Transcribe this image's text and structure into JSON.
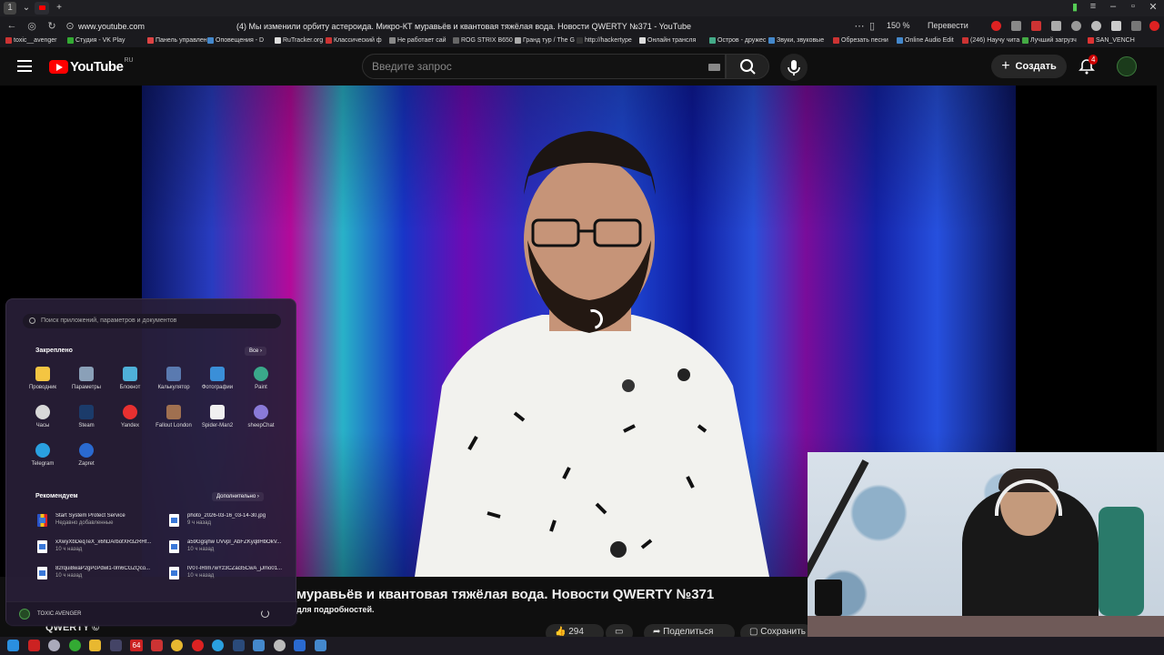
{
  "browser": {
    "url": "www.youtube.com",
    "page_title": "(4) Мы изменили орбиту астероида. Микро-КТ муравьёв и квантовая тяжёлая вода. Новости QWERTY №371 - YouTube",
    "zoom": "150 %",
    "translate": "Перевести",
    "tab_count_badge": "1",
    "bookmarks": [
      "toxic__avenger",
      "Студия - VK Play",
      "Панель управлен",
      "Оповещения - D",
      "RuTracker.org",
      "Классический ф",
      "Не работает сай",
      "ROG STRIX B650",
      "Гранд тур / The G",
      "http://hackertype",
      "Онлайн трансля",
      "Остров - дружес",
      "Звуки, звуковые",
      "Обрезать песни",
      "Online Audio Edit",
      "(246) Научу чита",
      "Лучший загрузч",
      "SAN_VENCH"
    ],
    "colors": {
      "tab_bg": "#1f1f23",
      "bar_bg": "#1a1a1e"
    }
  },
  "youtube": {
    "logo_text": "YouTube",
    "country_code": "RU",
    "search_placeholder": "Введите запрос",
    "create_label": "Создать",
    "notification_count": "4",
    "accent": "#ff0000"
  },
  "video": {
    "title_visible": "муравьёв и квантовая тяжёлая вода. Новости QWERTY №371",
    "subtitle_visible": "для подробностей.",
    "channel_visible": "QWERTY ©",
    "likes": "294",
    "share_label": "Поделиться",
    "save_label": "Сохранить"
  },
  "start_menu": {
    "search_placeholder": "Поиск приложений, параметров и документов",
    "pinned_heading": "Закреплено",
    "all_label": "Все",
    "pinned_apps": [
      {
        "label": "Проводник",
        "icon": "folder-icon",
        "color": "#f4c542"
      },
      {
        "label": "Параметры",
        "icon": "gear-icon",
        "color": "#8aa0b8"
      },
      {
        "label": "Блокнот",
        "icon": "notepad-icon",
        "color": "#4fb0d8"
      },
      {
        "label": "Калькулятор",
        "icon": "calculator-icon",
        "color": "#5a7ab0"
      },
      {
        "label": "Фотографии",
        "icon": "photos-icon",
        "color": "#3a8fd8"
      },
      {
        "label": "Paint",
        "icon": "paint-icon",
        "color": "#3aa88a"
      },
      {
        "label": "Часы",
        "icon": "clock-icon",
        "color": "#d8d8d8"
      },
      {
        "label": "Steam",
        "icon": "steam-icon",
        "color": "#1b3b6a"
      },
      {
        "label": "Yandex",
        "icon": "yandex-icon",
        "color": "#e83030"
      },
      {
        "label": "Fallout London",
        "icon": "fallout-icon",
        "color": "#a07050"
      },
      {
        "label": "Spider-Man2",
        "icon": "file-icon",
        "color": "#f0f0f0"
      },
      {
        "label": "sheepChat",
        "icon": "chat-icon",
        "color": "#8a7ad8"
      },
      {
        "label": "Telegram",
        "icon": "telegram-icon",
        "color": "#2aa0e0"
      },
      {
        "label": "Zapret",
        "icon": "globe-icon",
        "color": "#2a6ad0"
      }
    ],
    "recommended_heading": "Рекомендуем",
    "more_label": "Дополнительно",
    "recommended": [
      {
        "name": "Start System Protect Service",
        "time": "Недавно добавленные"
      },
      {
        "name": "photo_2026-03-16_03-14-30.jpg",
        "time": "9 ч назад"
      },
      {
        "name": "xXwyXbDeqTeX_x6hDArbofXR3ZRHf...",
        "time": "10 ч назад"
      },
      {
        "name": "a59Ggsjhw UVvpl_AbFZKyq8HbOkV...",
        "time": "10 ч назад"
      },
      {
        "name": "82rqui8waP2gPcPdwl1-0m6CGZQco...",
        "time": "10 ч назад"
      },
      {
        "name": "lV0T-lRIm7wYz3CZai35CwA_jJmo01...",
        "time": "10 ч назад"
      }
    ],
    "user_name": "TOXIC AVENGER"
  },
  "taskbar": {
    "items": [
      "start-icon",
      "app-icon",
      "search-icon",
      "xbox-icon",
      "explorer-icon",
      "steam-icon",
      "counter-icon",
      "notes-icon",
      "chrome-icon",
      "yandex-icon",
      "telegram-icon",
      "steam-alt-icon",
      "store-icon",
      "vpn-icon",
      "photos-icon",
      "steam-sm-icon"
    ],
    "counter_label": "64"
  }
}
